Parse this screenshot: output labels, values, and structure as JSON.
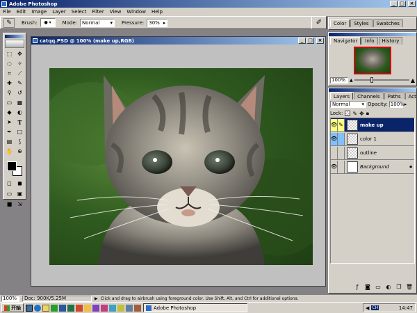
{
  "app": {
    "title": "Adobe Photoshop",
    "menu": [
      "File",
      "Edit",
      "Image",
      "Layer",
      "Select",
      "Filter",
      "View",
      "Window",
      "Help"
    ]
  },
  "options": {
    "brush_label": "Brush:",
    "mode_label": "Mode:",
    "mode_value": "Normal",
    "pressure_label": "Pressure:",
    "pressure_value": "30%"
  },
  "document": {
    "title": "catqq.PSD @ 100% (make up,RGB)"
  },
  "status": {
    "zoom": "100%",
    "doc_size": "Doc: 900K/5.25M",
    "hint": "Click and drag to airbrush using foreground color.  Use Shift, Alt, and Ctrl for additional options."
  },
  "palette_color": {
    "tabs": [
      "Color",
      "Styles",
      "Swatches"
    ]
  },
  "navigator": {
    "tabs": [
      "Navigator",
      "Info",
      "History"
    ],
    "zoom": "100%"
  },
  "layers_panel": {
    "tabs": [
      "Layers",
      "Channels",
      "Paths",
      "Actions"
    ],
    "blend_mode": "Normal",
    "opacity_label": "Opacity:",
    "opacity_value": "100%",
    "lock_label": "Lock:",
    "layers": [
      {
        "name": "make up",
        "selected": true
      },
      {
        "name": "color 1",
        "selected": false
      },
      {
        "name": "outline",
        "selected": false
      },
      {
        "name": "Background",
        "selected": false
      }
    ]
  },
  "taskbar": {
    "start_label": "开始",
    "task_label": "Adobe Photoshop",
    "clock": "14:47",
    "ime": "CH"
  },
  "colors": {
    "titlebar": "#0a246a",
    "chrome": "#d4d0c8",
    "workspace": "#848284",
    "canvas_bg": "#2f5a1f"
  }
}
